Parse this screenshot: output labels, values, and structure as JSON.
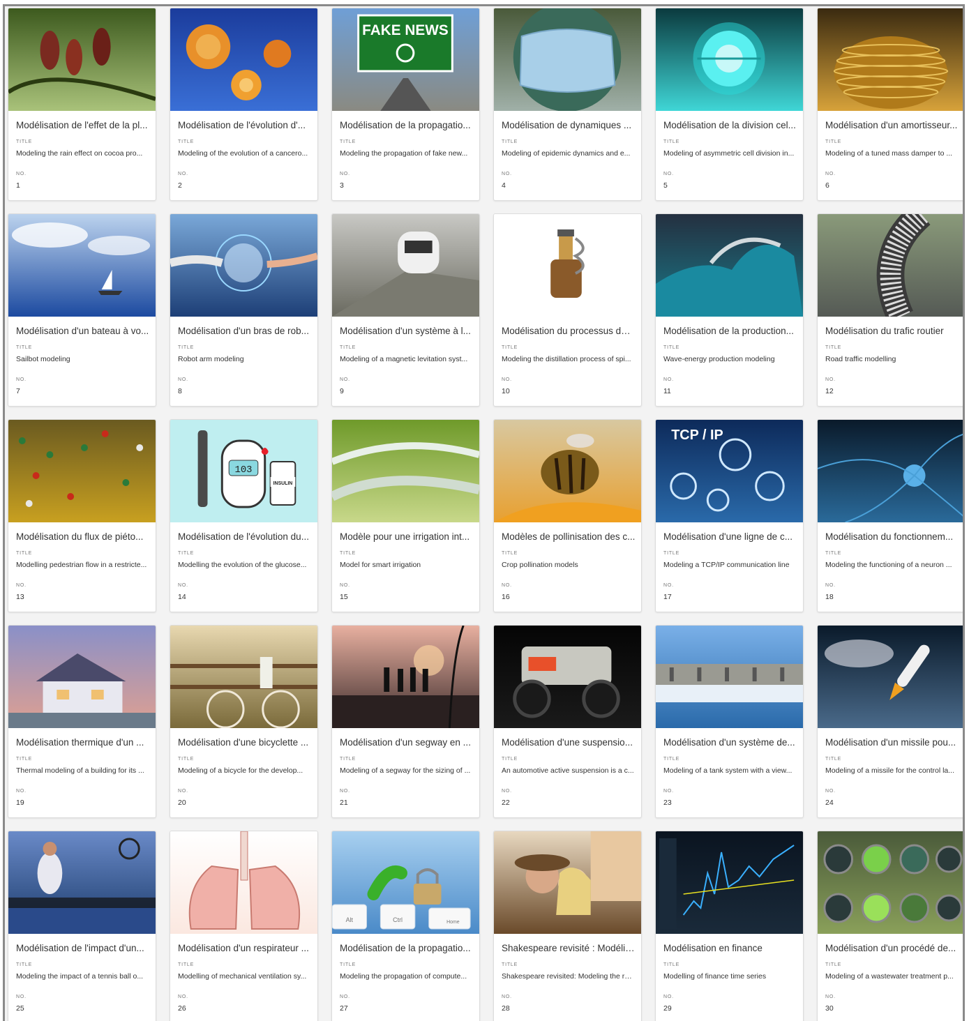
{
  "labels": {
    "title": "TITLE",
    "no": "NO."
  },
  "cards": [
    {
      "heading": "Modélisation de l'effet de la pl...",
      "title": "Modeling the rain effect on cocoa pro...",
      "no": "1",
      "icon": "cocoa-pods-image",
      "bg": [
        "#3d5a1e",
        "#a9c27a"
      ]
    },
    {
      "heading": "Modélisation de l'évolution d'...",
      "title": "Modeling of the evolution of a cancero...",
      "no": "2",
      "icon": "cancer-cells-image",
      "bg": [
        "#1b3c9c",
        "#3a6fd6"
      ]
    },
    {
      "heading": "Modélisation de la propagatio...",
      "title": "Modeling the propagation of fake new...",
      "no": "3",
      "icon": "fake-news-sign-image",
      "bg": [
        "#6f9fd6",
        "#8a8a82"
      ],
      "sign": "FAKE NEWS"
    },
    {
      "heading": "Modélisation de dynamiques ...",
      "title": "Modeling of epidemic dynamics and e...",
      "no": "4",
      "icon": "globe-mask-image",
      "bg": [
        "#4a5a3a",
        "#a0b0a8"
      ]
    },
    {
      "heading": "Modélisation de la division cel...",
      "title": "Modeling of asymmetric cell division in...",
      "no": "5",
      "icon": "cell-division-image",
      "bg": [
        "#0b3a3e",
        "#3fd6d6"
      ]
    },
    {
      "heading": "Modélisation d'un amortisseur...",
      "title": "Modeling of a tuned mass damper to ...",
      "no": "6",
      "icon": "mass-damper-image",
      "bg": [
        "#3a2a10",
        "#d7a23a"
      ]
    },
    {
      "heading": "Modélisation d'un bateau à vo...",
      "title": "Sailbot modeling",
      "no": "7",
      "icon": "sailboat-image",
      "bg": [
        "#bcd3ee",
        "#1c4aa0"
      ]
    },
    {
      "heading": "Modélisation d'un bras de rob...",
      "title": "Robot arm modeling",
      "no": "8",
      "icon": "robot-arm-image",
      "bg": [
        "#7aa8d8",
        "#1d3f77"
      ]
    },
    {
      "heading": "Modélisation d'un système à l...",
      "title": "Modeling of a magnetic levitation syst...",
      "no": "9",
      "icon": "maglev-train-image",
      "bg": [
        "#c8c8c4",
        "#6a6a60"
      ]
    },
    {
      "heading": "Modélisation du processus de ...",
      "title": "Modeling the distillation process of spi...",
      "no": "10",
      "icon": "distillery-image",
      "bg": [
        "#ffffff",
        "#ffffff"
      ]
    },
    {
      "heading": "Modélisation de la production...",
      "title": "Wave-energy production modeling",
      "no": "11",
      "icon": "ocean-wave-image",
      "bg": [
        "#243040",
        "#1a7a8a"
      ]
    },
    {
      "heading": "Modélisation du trafic routier",
      "title": "Road traffic modelling",
      "no": "12",
      "icon": "road-traffic-image",
      "bg": [
        "#8a9a7a",
        "#555a55"
      ]
    },
    {
      "heading": "Modélisation du flux de piéto...",
      "title": "Modelling pedestrian flow in a restricte...",
      "no": "13",
      "icon": "crowd-image",
      "bg": [
        "#6a5a20",
        "#c8a020"
      ]
    },
    {
      "heading": "Modélisation de l'évolution du...",
      "title": "Modelling the evolution of the glucose...",
      "no": "14",
      "icon": "glucose-meter-image",
      "bg": [
        "#bfeef0",
        "#bfeef0"
      ],
      "meter": "103",
      "vial": "INSULIN"
    },
    {
      "heading": "Modèle pour une irrigation int...",
      "title": "Model for smart irrigation",
      "no": "15",
      "icon": "rice-terraces-image",
      "bg": [
        "#6f9a2a",
        "#c8d88a"
      ]
    },
    {
      "heading": "Modèles de pollinisation des c...",
      "title": "Crop pollination models",
      "no": "16",
      "icon": "bee-flower-image",
      "bg": [
        "#d8c8a0",
        "#e8a030"
      ]
    },
    {
      "heading": "Modélisation d'une ligne de c...",
      "title": "Modeling a TCP/IP communication line",
      "no": "17",
      "icon": "network-gears-image",
      "bg": [
        "#0d2a5a",
        "#2a6aaa"
      ],
      "banner": "TCP / IP"
    },
    {
      "heading": "Modélisation du fonctionnem...",
      "title": "Modeling the functioning of a neuron ...",
      "no": "18",
      "icon": "neuron-image",
      "bg": [
        "#0a1a2a",
        "#2a6a9a"
      ]
    },
    {
      "heading": "Modélisation thermique d'un ...",
      "title": "Thermal modeling of a building for its ...",
      "no": "19",
      "icon": "house-image",
      "bg": [
        "#8a90c8",
        "#e0a090"
      ]
    },
    {
      "heading": "Modélisation d'une bicyclette ...",
      "title": "Modeling of a bicycle for the develop...",
      "no": "20",
      "icon": "bicycle-image",
      "bg": [
        "#e8d8b0",
        "#7a6a3a"
      ]
    },
    {
      "heading": "Modélisation d'un segway en ...",
      "title": "Modeling of a segway for the sizing of ...",
      "no": "21",
      "icon": "segway-sunset-image",
      "bg": [
        "#e8b0a0",
        "#3a2a2a"
      ]
    },
    {
      "heading": "Modélisation d'une suspensio...",
      "title": "An automotive active suspension is a c...",
      "no": "22",
      "icon": "monster-truck-image",
      "bg": [
        "#050505",
        "#1a1a1a"
      ]
    },
    {
      "heading": "Modélisation d'un système de...",
      "title": "Modeling of a tank system with a view...",
      "no": "23",
      "icon": "hydro-dam-image",
      "bg": [
        "#7ab0e8",
        "#2a6aaa"
      ]
    },
    {
      "heading": "Modélisation d'un missile pou...",
      "title": "Modeling of a missile for the control la...",
      "no": "24",
      "icon": "rocket-image",
      "bg": [
        "#0a1a2a",
        "#4a6a8a"
      ]
    },
    {
      "heading": "Modélisation de l'impact d'un...",
      "title": "Modeling the impact of a tennis ball o...",
      "no": "25",
      "icon": "tennis-player-image",
      "bg": [
        "#6a8ac8",
        "#1a3a6a"
      ]
    },
    {
      "heading": "Modélisation d'un respirateur ...",
      "title": "Modelling of mechanical ventilation sy...",
      "no": "26",
      "icon": "lungs-image",
      "bg": [
        "#ffffff",
        "#fbe8e0"
      ]
    },
    {
      "heading": "Modélisation de la propagatio...",
      "title": "Modeling the propagation of compute...",
      "no": "27",
      "icon": "keyboard-worm-image",
      "bg": [
        "#a8d0f0",
        "#4a8ac8"
      ],
      "keys": [
        "Alt",
        "Ctrl",
        "Home"
      ]
    },
    {
      "heading": "Shakespeare revisité : Modélis...",
      "title": "Shakespeare revisited: Modeling the re...",
      "no": "28",
      "icon": "couple-image",
      "bg": [
        "#e8d8c0",
        "#6a4a2a"
      ]
    },
    {
      "heading": "Modélisation en finance",
      "title": "Modelling of finance time series",
      "no": "29",
      "icon": "stock-chart-image",
      "bg": [
        "#0a1420",
        "#1a2a3a"
      ]
    },
    {
      "heading": "Modélisation d'un procédé de...",
      "title": "Modeling of a wastewater treatment p...",
      "no": "30",
      "icon": "water-treatment-image",
      "bg": [
        "#4a5a3a",
        "#8aa05a"
      ]
    }
  ]
}
